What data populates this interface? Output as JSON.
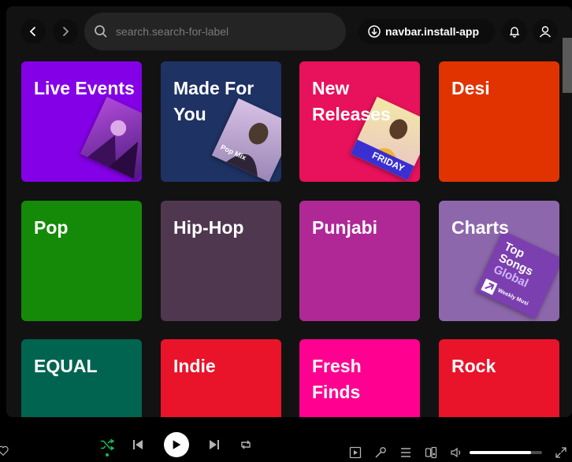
{
  "search": {
    "placeholder": "search.search-for-label"
  },
  "navbar": {
    "install_label": "navbar.install-app"
  },
  "categories": [
    {
      "title": "Live Events",
      "color": "#8400e7"
    },
    {
      "title": "Made For You",
      "color": "#1e3264"
    },
    {
      "title": "New Releases",
      "color": "#e8115b"
    },
    {
      "title": "Desi",
      "color": "#e13300"
    },
    {
      "title": "Pop",
      "color": "#148a08"
    },
    {
      "title": "Hip-Hop",
      "color": "#503750"
    },
    {
      "title": "Punjabi",
      "color": "#af2896"
    },
    {
      "title": "Charts",
      "color": "#8d67ab"
    },
    {
      "title": "EQUAL",
      "color": "#006450"
    },
    {
      "title": "Indie",
      "color": "#e91429"
    },
    {
      "title": "Fresh Finds",
      "color": "#ff0090"
    },
    {
      "title": "Rock",
      "color": "#e91429"
    }
  ],
  "artwork": {
    "made_for_you": "Pop Mix",
    "charts_line1": "Top",
    "charts_line2": "Songs",
    "charts_line3": "Global",
    "charts_sub": "Weekly Musi",
    "new_releases_label": "FRIDAY"
  },
  "player": {
    "volume_fraction": 0.85
  }
}
